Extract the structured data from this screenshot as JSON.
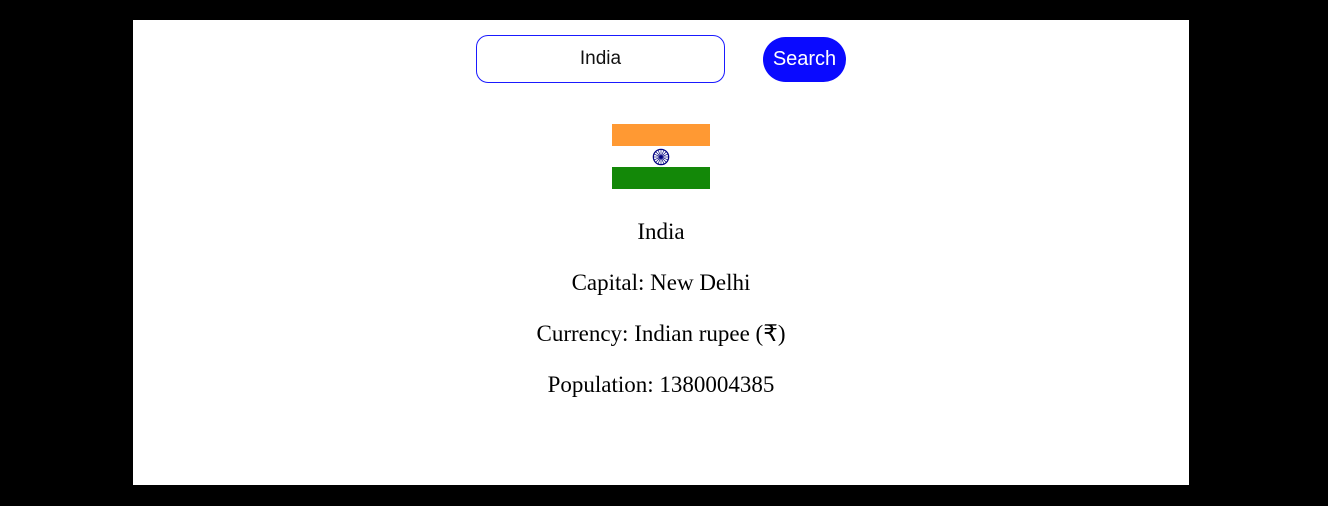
{
  "search": {
    "value": "India",
    "button_label": "Search"
  },
  "flag": {
    "colors": {
      "saffron": "#ff9933",
      "white": "#ffffff",
      "green": "#138808",
      "chakra": "#000080"
    },
    "icon": "india-flag-icon"
  },
  "country": {
    "name": "India",
    "capital_label": "Capital: ",
    "capital": "New Delhi",
    "currency_label": "Currency: ",
    "currency": "Indian rupee (₹)",
    "population_label": "Population: ",
    "population": "1380004385"
  },
  "colors": {
    "page_background": "#000000",
    "card_background": "#ffffff",
    "accent": "#0a0aff",
    "input_border": "#1a1aff"
  }
}
